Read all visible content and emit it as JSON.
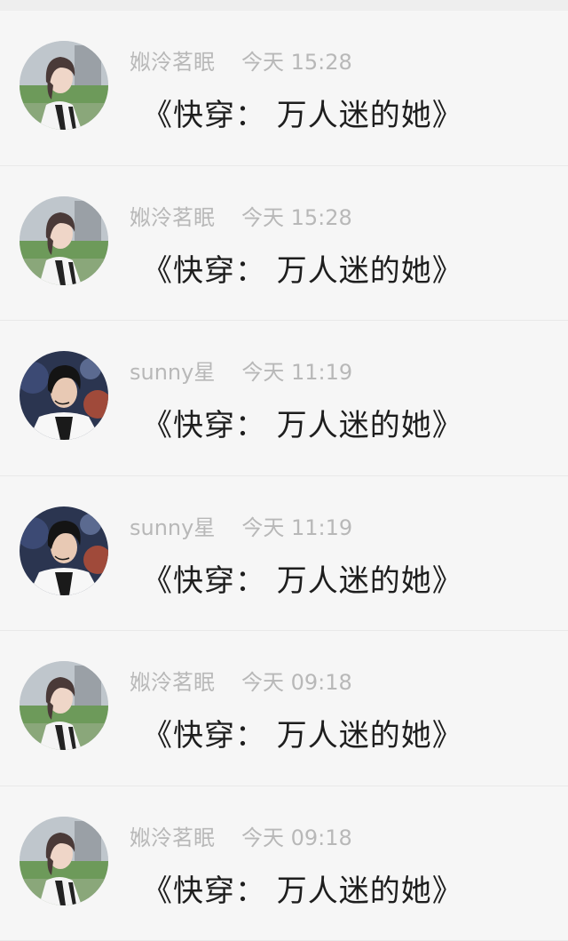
{
  "messages": [
    {
      "sender": "娰泠茗眠",
      "time": "今天 15:28",
      "text": "《快穿：  万人迷的她》",
      "avatar_icon": "girl-avatar-icon"
    },
    {
      "sender": "娰泠茗眠",
      "time": "今天 15:28",
      "text": "《快穿：  万人迷的她》",
      "avatar_icon": "girl-avatar-icon"
    },
    {
      "sender": "sunny星",
      "time": "今天 11:19",
      "text": "《快穿：  万人迷的她》",
      "avatar_icon": "boy-avatar-icon"
    },
    {
      "sender": "sunny星",
      "time": "今天 11:19",
      "text": "《快穿：  万人迷的她》",
      "avatar_icon": "boy-avatar-icon"
    },
    {
      "sender": "娰泠茗眠",
      "time": "今天 09:18",
      "text": "《快穿：  万人迷的她》",
      "avatar_icon": "girl-avatar-icon"
    },
    {
      "sender": "娰泠茗眠",
      "time": "今天 09:18",
      "text": "《快穿：  万人迷的她》",
      "avatar_icon": "girl-avatar-icon"
    }
  ]
}
